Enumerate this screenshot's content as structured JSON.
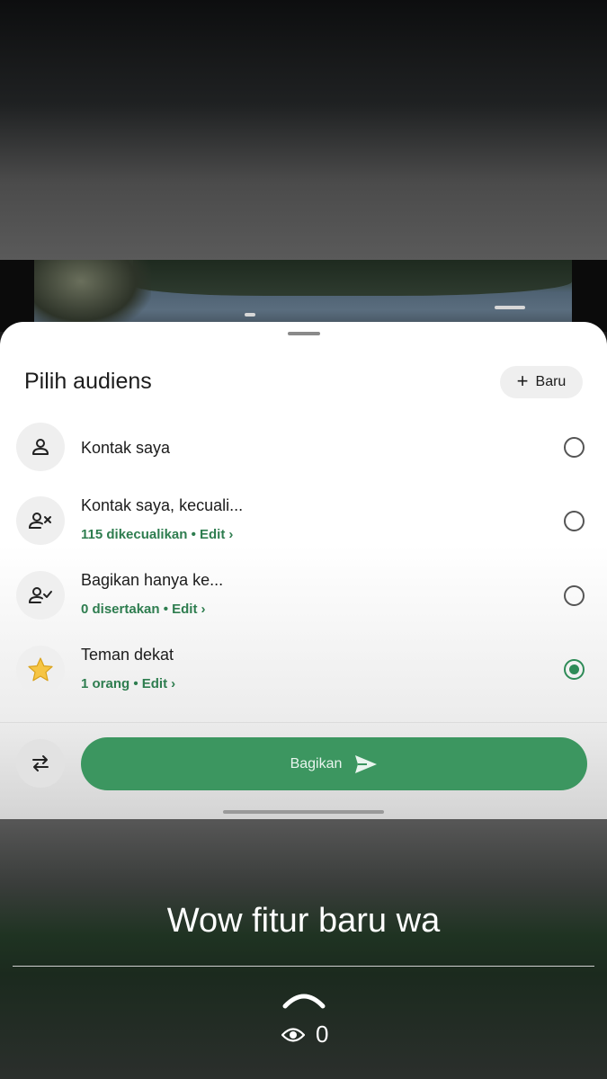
{
  "sheet": {
    "title": "Pilih audiens",
    "new_button_label": "Baru",
    "options": [
      {
        "title": "Kontak saya",
        "subtitle": "",
        "selected": false,
        "icon": "person-icon"
      },
      {
        "title": "Kontak saya, kecuali...",
        "subtitle": "115 dikecualikan • Edit",
        "selected": false,
        "icon": "person-remove-icon"
      },
      {
        "title": "Bagikan hanya ke...",
        "subtitle": "0 disertakan • Edit",
        "selected": false,
        "icon": "person-check-icon"
      },
      {
        "title": "Teman dekat",
        "subtitle": "1 orang • Edit",
        "selected": true,
        "icon": "star-icon"
      }
    ],
    "share_button_label": "Bagikan"
  },
  "story": {
    "caption": "Wow fitur baru wa",
    "view_count": "0"
  },
  "colors": {
    "accent_green": "#3c9660",
    "link_green": "#2e7d4f"
  }
}
